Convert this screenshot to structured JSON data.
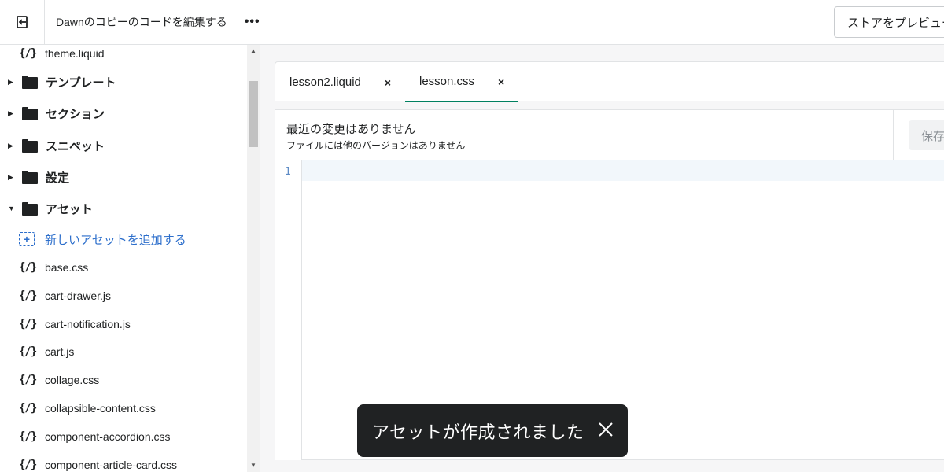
{
  "topbar": {
    "back_icon": "exit-arrow-icon",
    "title": "Dawnのコピーのコードを編集する",
    "more_label": "•••",
    "preview_label": "ストアをプレビュー"
  },
  "sidebar": {
    "top_file": "theme.liquid",
    "folders": [
      {
        "label": "テンプレート",
        "expanded": false
      },
      {
        "label": "セクション",
        "expanded": false
      },
      {
        "label": "スニペット",
        "expanded": false
      },
      {
        "label": "設定",
        "expanded": false
      },
      {
        "label": "アセット",
        "expanded": true
      }
    ],
    "add_asset_label": "新しいアセットを追加する",
    "file_icon_glyph": "{/}",
    "asset_files": [
      "base.css",
      "cart-drawer.js",
      "cart-notification.js",
      "cart.js",
      "collage.css",
      "collapsible-content.css",
      "component-accordion.css",
      "component-article-card.css"
    ]
  },
  "tabs": [
    {
      "label": "lesson2.liquid",
      "close": "×",
      "active": false
    },
    {
      "label": "lesson.css",
      "close": "×",
      "active": true
    }
  ],
  "editor": {
    "header_title": "最近の変更はありません",
    "header_subtitle": "ファイルには他のバージョンはありません",
    "save_label": "保存する",
    "line_numbers": [
      "1"
    ]
  },
  "toast": {
    "message": "アセットが作成されました",
    "close_icon": "close-icon"
  },
  "colors": {
    "accent_green": "#008060",
    "link_blue": "#2c6ecb",
    "toast_bg": "#202223"
  }
}
